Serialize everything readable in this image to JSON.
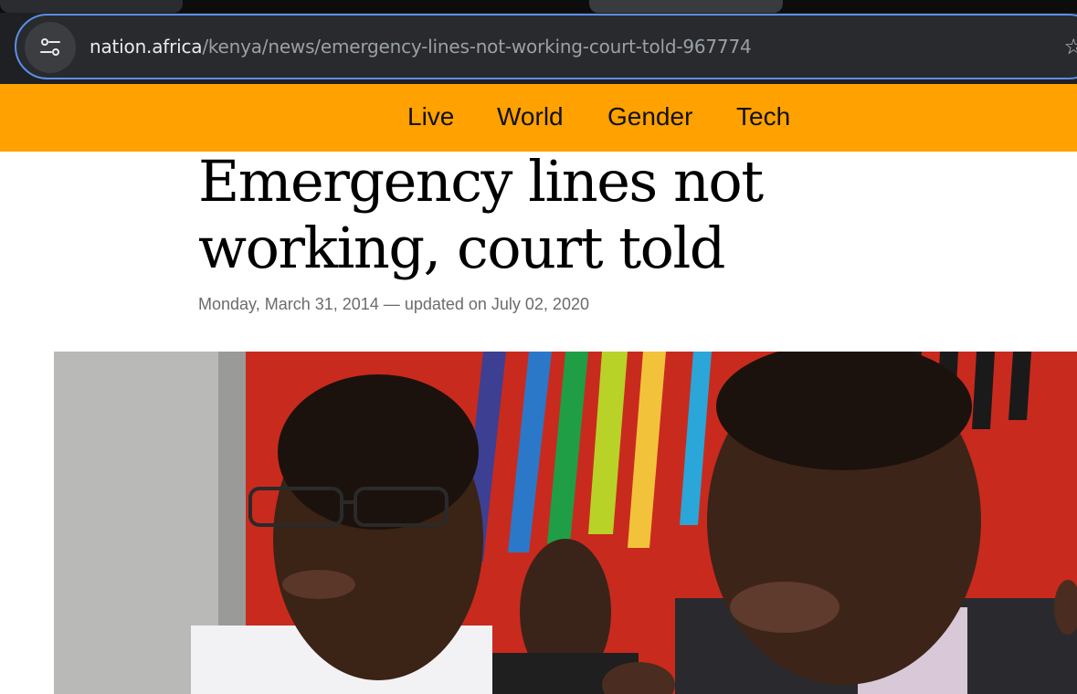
{
  "browser": {
    "url_host": "nation.africa",
    "url_path": "/kenya/news/emergency-lines-not-working-court-told-967774",
    "site_info_icon": "tune-icon",
    "bookmark_icon": "star-outline-icon"
  },
  "nav": {
    "items": [
      {
        "label": "Live"
      },
      {
        "label": "World"
      },
      {
        "label": "Gender"
      },
      {
        "label": "Tech"
      }
    ],
    "background_color": "#ffa100"
  },
  "article": {
    "headline": "Emergency lines not working, court told",
    "published": "Monday, March 31, 2014",
    "separator": "—",
    "updated": "updated on July 02, 2020"
  },
  "colors": {
    "browser_bg": "#1f2023",
    "omnibox_border": "#5a8fe8",
    "nav_bg": "#ffa100",
    "photo_backdrop": "#c92a1e"
  }
}
